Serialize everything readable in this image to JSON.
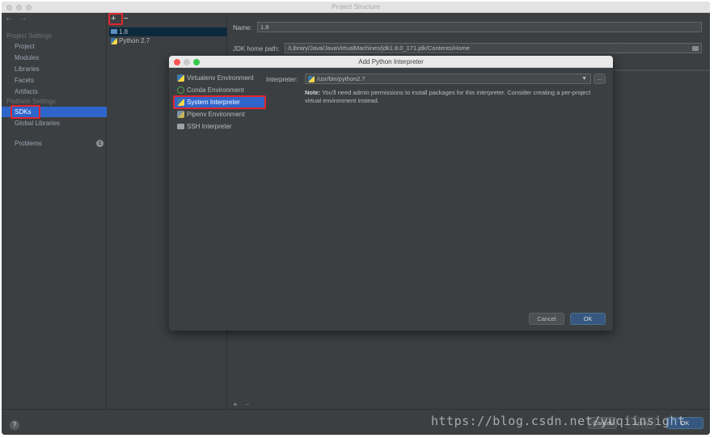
{
  "window": {
    "title": "Project Structure"
  },
  "sidebar": {
    "project_settings_header": "Project Settings",
    "project_items": [
      {
        "label": "Project"
      },
      {
        "label": "Modules"
      },
      {
        "label": "Libraries"
      },
      {
        "label": "Facets"
      },
      {
        "label": "Artifacts"
      }
    ],
    "platform_settings_header": "Platform Settings",
    "platform_items": [
      {
        "label": "SDKs"
      },
      {
        "label": "Global Libraries"
      }
    ],
    "problems": {
      "label": "Problems",
      "count": "2"
    }
  },
  "sdk_list": {
    "add_label": "+",
    "remove_label": "−",
    "items": [
      {
        "label": "1.8"
      },
      {
        "label": "Python 2.7"
      }
    ]
  },
  "detail": {
    "name_label": "Name:",
    "name_value": "1.8",
    "jdk_label": "JDK home path:",
    "jdk_value": "/Library/Java/JavaVirtualMachines/jdk1.8.0_171.jdk/Contents/Home",
    "add_label": "+",
    "remove_label": "−"
  },
  "dialog": {
    "title": "Add Python Interpreter",
    "types": [
      {
        "label": "Virtualenv Environment"
      },
      {
        "label": "Conda Environment"
      },
      {
        "label": "System Interpreter"
      },
      {
        "label": "Pipenv Environment"
      },
      {
        "label": "SSH Interpreter"
      }
    ],
    "interpreter_label": "Interpreter:",
    "interpreter_value": "/usr/bin/python2.7",
    "browse_label": "...",
    "note_bold": "Note:",
    "note_text": " You'll need admin permissions to install packages for this interpreter. Consider creating a per-project virtual environment instead.",
    "cancel_label": "Cancel",
    "ok_label": "OK"
  },
  "footer": {
    "help_label": "?",
    "cancel_label": "Cancel",
    "apply_label": "Apply",
    "ok_label": "OK"
  },
  "watermark": "https://blog.csdn.net/yuqiinsight",
  "colors": {
    "accent": "#2f65ca",
    "highlight_box": "#e0262e",
    "default_button": "#365880"
  }
}
